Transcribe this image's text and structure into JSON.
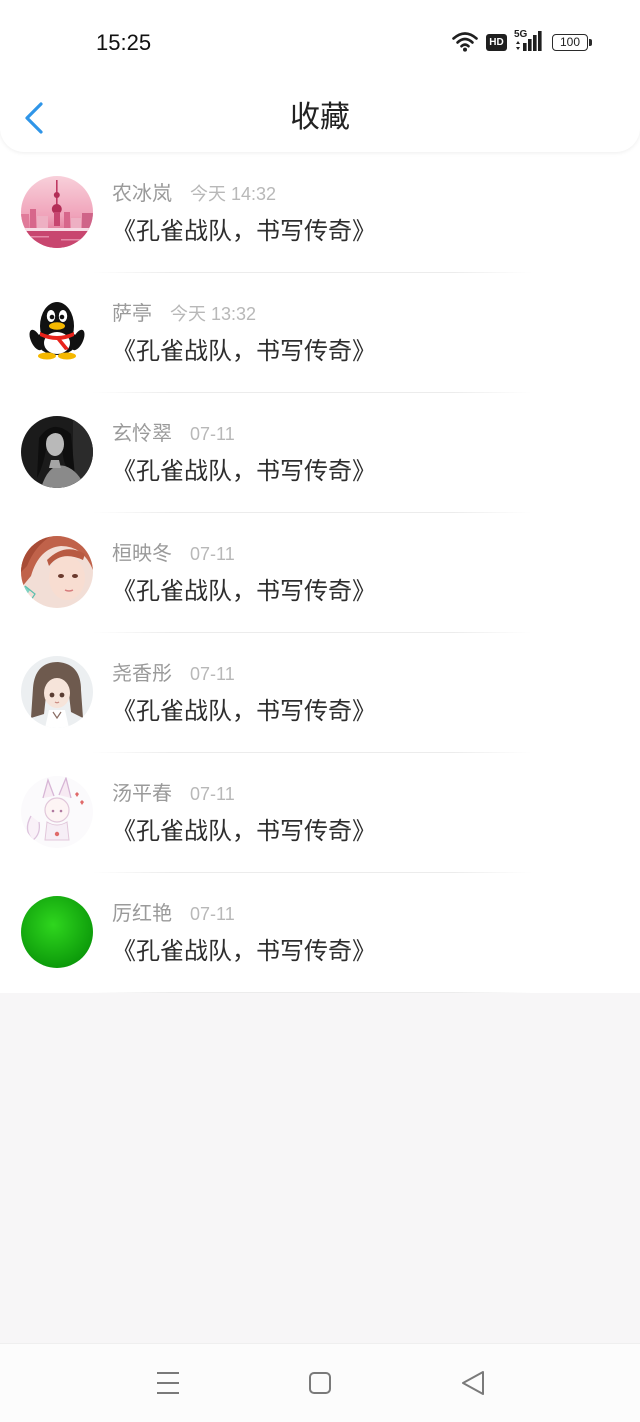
{
  "status_bar": {
    "time": "15:25",
    "hd_label": "HD",
    "network": "5G",
    "battery": "100",
    "icons": [
      "wifi-icon",
      "hd-icon",
      "signal-5g-icon",
      "battery-icon"
    ]
  },
  "header": {
    "title": "收藏",
    "back_icon": "chevron-left-icon"
  },
  "favorites": [
    {
      "name": "农冰岚",
      "time": "今天 14:32",
      "message": "《孔雀战队，书写传奇》",
      "avatar_icon": "avatar-city-skyline"
    },
    {
      "name": "萨亭",
      "time": "今天 13:32",
      "message": "《孔雀战队，书写传奇》",
      "avatar_icon": "avatar-qq-penguin"
    },
    {
      "name": "玄怜翠",
      "time": "07-11",
      "message": "《孔雀战队，书写传奇》",
      "avatar_icon": "avatar-dark-portrait"
    },
    {
      "name": "桓映冬",
      "time": "07-11",
      "message": "《孔雀战队，书写传奇》",
      "avatar_icon": "avatar-redhair-portrait"
    },
    {
      "name": "尧香彤",
      "time": "07-11",
      "message": "《孔雀战队，书写传奇》",
      "avatar_icon": "avatar-anime-girl"
    },
    {
      "name": "汤平春",
      "time": "07-11",
      "message": "《孔雀战队，书写传奇》",
      "avatar_icon": "avatar-fox-girl-sketch"
    },
    {
      "name": "厉红艳",
      "time": "07-11",
      "message": "《孔雀战队，书写传奇》",
      "avatar_icon": "avatar-green-circle"
    }
  ],
  "nav_bar": {
    "icons": [
      "menu-icon",
      "home-square-icon",
      "back-triangle-icon"
    ]
  },
  "colors": {
    "accent": "#2f95e8",
    "page_background": "#f7f6f7",
    "list_background": "#ffffff",
    "name_text": "#9a9a9a",
    "time_text": "#b8b8b8",
    "message_text": "#2e2e2e",
    "title_text": "#222222"
  }
}
